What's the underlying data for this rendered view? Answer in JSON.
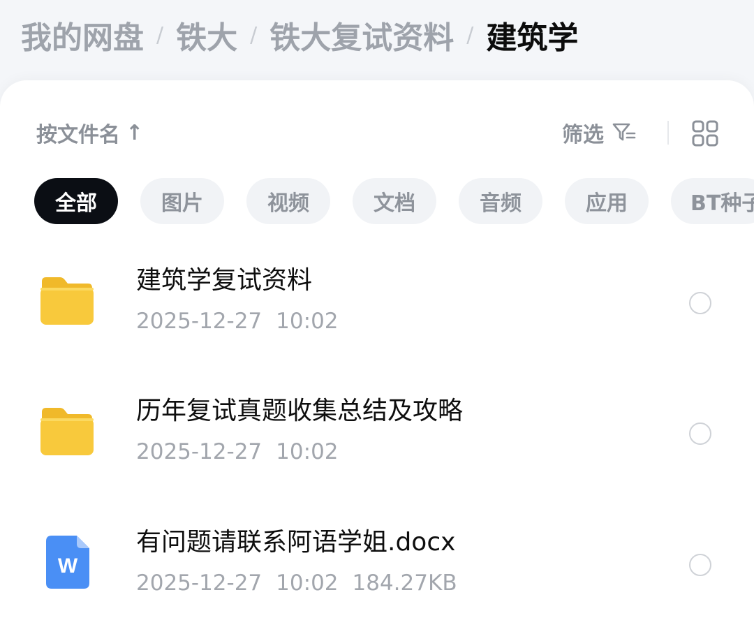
{
  "breadcrumb": {
    "items": [
      "我的网盘",
      "铁大",
      "铁大复试资料"
    ],
    "current": "建筑学",
    "separator": "/"
  },
  "toolbar": {
    "sort_label": "按文件名",
    "sort_arrow": "↑",
    "filter_label": "筛选",
    "filter_icon": "filter-icon",
    "view_icon": "grid-view-icon"
  },
  "filters": {
    "chips": [
      "全部",
      "图片",
      "视频",
      "文档",
      "音频",
      "应用",
      "BT种子"
    ],
    "selected": "全部"
  },
  "files": [
    {
      "name": "建筑学复试资料",
      "date": "2025-12-27",
      "time": "10:02",
      "size": "",
      "type": "folder",
      "icon": "folder-icon"
    },
    {
      "name": "历年复试真题收集总结及攻略",
      "date": "2025-12-27",
      "time": "10:02",
      "size": "",
      "type": "folder",
      "icon": "folder-icon"
    },
    {
      "name": "有问题请联系阿语学姐.docx",
      "date": "2025-12-27",
      "time": "10:02",
      "size": "184.27KB",
      "type": "word",
      "icon": "word-doc-icon"
    }
  ],
  "colors": {
    "folder": "#f8c93c",
    "word": "#4a8ff5",
    "active_chip": "#0b0e14"
  }
}
